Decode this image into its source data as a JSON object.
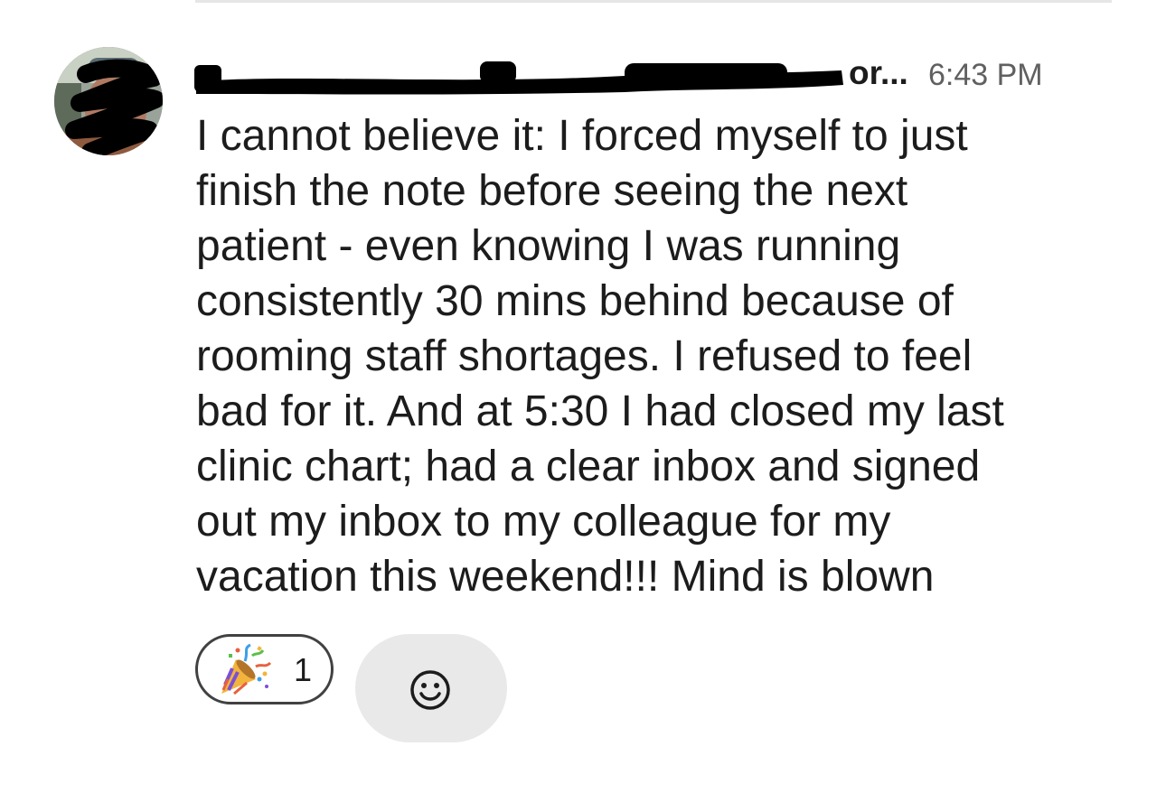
{
  "message": {
    "sender": "Or...",
    "sender_visible_suffix": "or...",
    "timestamp": "6:43 PM",
    "text": "I cannot believe it: I forced myself to just\nfinish the note before seeing the next\npatient - even knowing I was running\nconsistently 30 mins behind because of\nrooming staff shortages. I refused to feel\nbad for it. And at 5:30 I had closed my last\nclinic chart; had a clear inbox and signed\nout my inbox to my colleague for my\nvacation this weekend!!! Mind is blown"
  },
  "reactions": [
    {
      "emoji": "party-popper",
      "count": "1"
    }
  ],
  "icons": {
    "avatar": "avatar-photo-redacted",
    "reaction": "party-popper-icon",
    "add_reaction": "smile-add-reaction-icon"
  },
  "colors": {
    "text": "#1d1c1d",
    "timestamp": "#616061",
    "pill_border": "#414141",
    "add_reaction_bg": "#e9e9ea",
    "redaction": "#000000"
  }
}
